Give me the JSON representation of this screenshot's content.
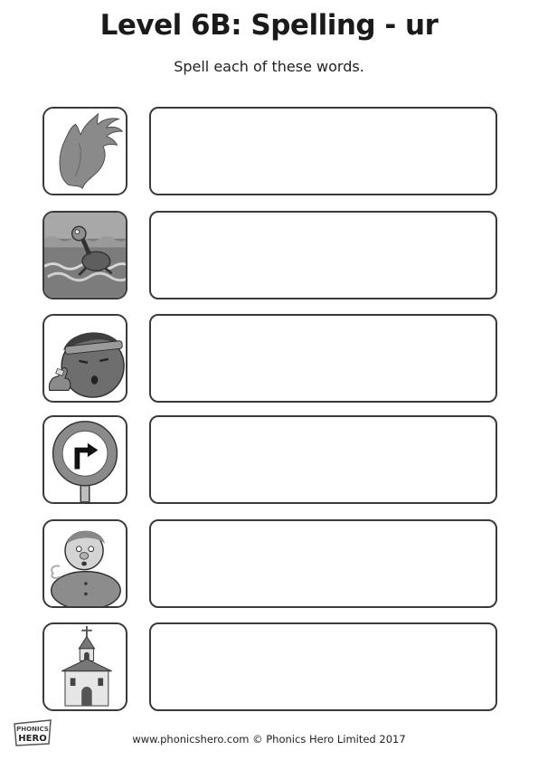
{
  "header": {
    "title": "Level 6B: Spelling - ur",
    "instruction": "Spell each of these words."
  },
  "rows": [
    {
      "icon": "fur-icon"
    },
    {
      "icon": "turtle-icon"
    },
    {
      "icon": "hurt-boy-icon"
    },
    {
      "icon": "turn-right-sign-icon"
    },
    {
      "icon": "burp-man-icon"
    },
    {
      "icon": "church-icon"
    }
  ],
  "footer": {
    "credit": "www.phonicshero.com © Phonics Hero Limited 2017"
  },
  "logo": {
    "text": "PHONICS HERO"
  }
}
